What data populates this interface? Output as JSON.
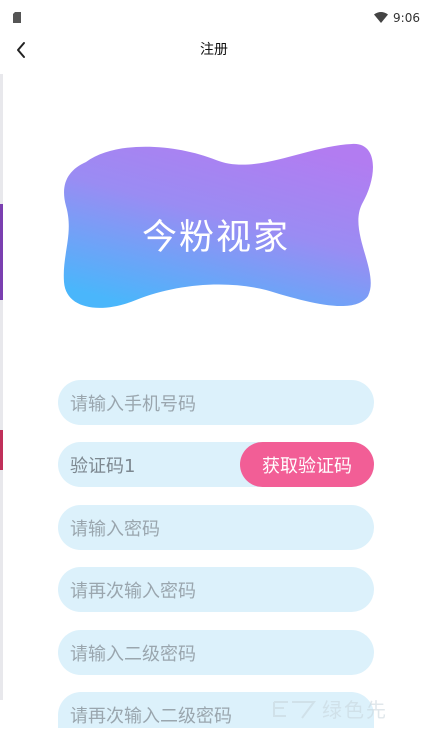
{
  "status_bar": {
    "time": "9:06",
    "left_icon": "sim-card-icon",
    "wifi_icon": "wifi-icon"
  },
  "header": {
    "back_icon": "chevron-left-icon",
    "title": "注册"
  },
  "logo": {
    "text": "今粉视家",
    "gradient_top": "#b27cf1",
    "gradient_bottom": "#4ab6fb"
  },
  "form": {
    "phone_placeholder": "请输入手机号码",
    "code_value": "验证码1",
    "get_code_label": "获取验证码",
    "password_placeholder": "请输入密码",
    "confirm_password_placeholder": "请再次输入密码",
    "secondary_password_placeholder": "请输入二级密码",
    "confirm_secondary_password_placeholder": "请再次输入二级密码"
  },
  "colors": {
    "field_background": "#dcf1fb",
    "placeholder_text": "#9aa6ae",
    "accent_button": "#f25e96"
  },
  "watermark": {
    "text": "绿色先"
  }
}
